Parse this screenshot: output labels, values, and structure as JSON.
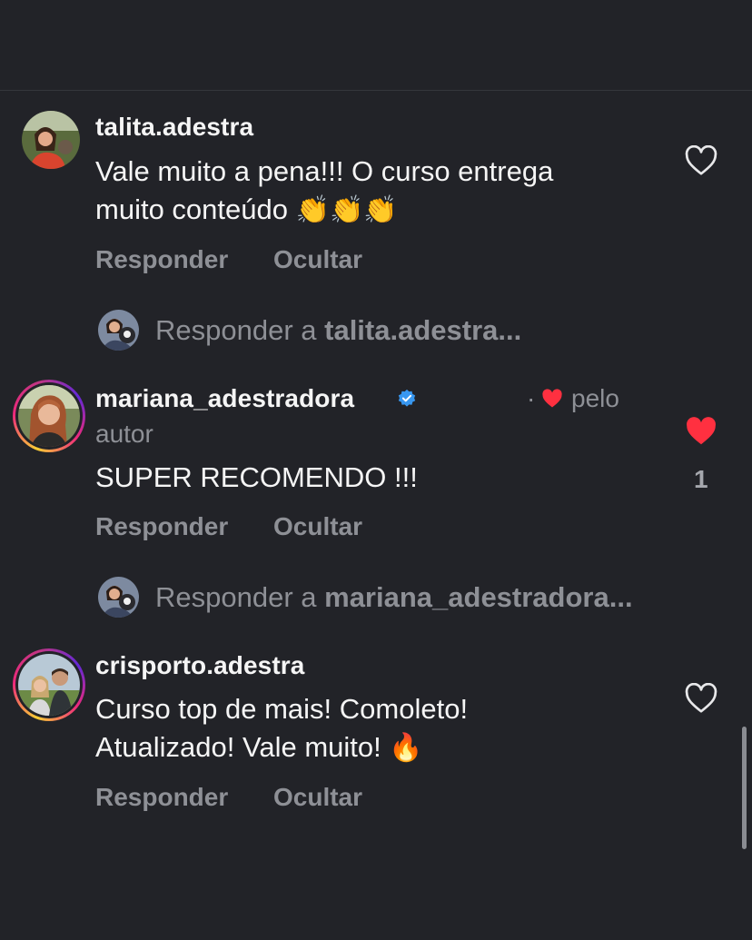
{
  "comments": [
    {
      "username": "talita.adestra",
      "text_line1": "Vale muito a pena!!! O curso entrega",
      "text_line2": "muito conteúdo",
      "emoji": "👏👏👏",
      "reply_label": "Responder",
      "hide_label": "Ocultar",
      "liked": false
    },
    {
      "username": "mariana_adestradora",
      "verified": true,
      "liked_by_author_prefix": "·",
      "liked_by_author_line1": "pelo",
      "liked_by_author_line2": "autor",
      "text_line1": "SUPER RECOMENDO !!!",
      "reply_label": "Responder",
      "hide_label": "Ocultar",
      "liked": true,
      "like_count": "1"
    },
    {
      "username": "crisporto.adestra",
      "text_line1": "Curso top de mais! Comoleto!",
      "text_line2": "Atualizado! Vale muito!",
      "emoji": "🔥",
      "reply_label": "Responder",
      "hide_label": "Ocultar",
      "liked": false
    }
  ],
  "reply_prompts": [
    {
      "prefix": "Responder a ",
      "target": "talita.adestra..."
    },
    {
      "prefix": "Responder a ",
      "target": "mariana_adestradora..."
    }
  ],
  "colors": {
    "background": "#222328",
    "text": "#f5f5f5",
    "muted": "#8e9096",
    "like_red": "#ff3040",
    "verified_blue": "#3897f0"
  }
}
